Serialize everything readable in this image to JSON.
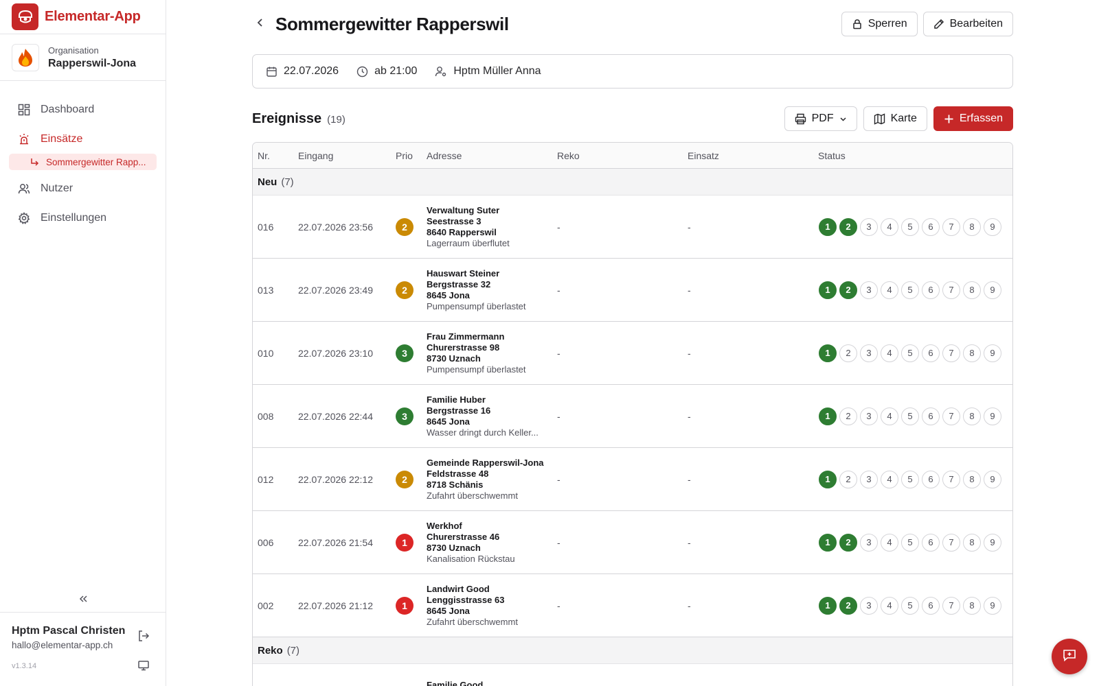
{
  "app": {
    "title": "Elementar-App"
  },
  "org": {
    "label": "Organisation",
    "name": "Rapperswil-Jona"
  },
  "nav": {
    "dashboard": "Dashboard",
    "einsaetze": "Einsätze",
    "sub": "Sommergewitter Rapp...",
    "nutzer": "Nutzer",
    "einstellungen": "Einstellungen"
  },
  "user": {
    "name": "Hptm Pascal Christen",
    "email": "hallo@elementar-app.ch",
    "version": "v1.3.14"
  },
  "page": {
    "title": "Sommergewitter Rapperswil",
    "lock_label": "Sperren",
    "edit_label": "Bearbeiten",
    "date": "22.07.2026",
    "time": "ab 21:00",
    "commander": "Hptm Müller Anna"
  },
  "events": {
    "title": "Ereignisse",
    "count": "(19)",
    "pdf_label": "PDF",
    "map_label": "Karte",
    "add_label": "Erfassen"
  },
  "table": {
    "headers": {
      "nr": "Nr.",
      "eingang": "Eingang",
      "prio": "Prio",
      "adresse": "Adresse",
      "reko": "Reko",
      "einsatz": "Einsatz",
      "status": "Status"
    },
    "groups": [
      {
        "name": "Neu",
        "count": "(7)",
        "rows": [
          {
            "nr": "016",
            "eingang": "22.07.2026 23:56",
            "prio": "2",
            "name": "Verwaltung Suter",
            "street": "Seestrasse 3",
            "city": "8640 Rapperswil",
            "desc": "Lagerraum überflutet",
            "reko": "-",
            "einsatz": "-",
            "status_done": 2
          },
          {
            "nr": "013",
            "eingang": "22.07.2026 23:49",
            "prio": "2",
            "name": "Hauswart Steiner",
            "street": "Bergstrasse 32",
            "city": "8645 Jona",
            "desc": "Pumpensumpf überlastet",
            "reko": "-",
            "einsatz": "-",
            "status_done": 2
          },
          {
            "nr": "010",
            "eingang": "22.07.2026 23:10",
            "prio": "3",
            "name": "Frau Zimmermann",
            "street": "Churerstrasse 98",
            "city": "8730 Uznach",
            "desc": "Pumpensumpf überlastet",
            "reko": "-",
            "einsatz": "-",
            "status_done": 1
          },
          {
            "nr": "008",
            "eingang": "22.07.2026 22:44",
            "prio": "3",
            "name": "Familie Huber",
            "street": "Bergstrasse 16",
            "city": "8645 Jona",
            "desc": "Wasser dringt durch Keller...",
            "reko": "-",
            "einsatz": "-",
            "status_done": 1
          },
          {
            "nr": "012",
            "eingang": "22.07.2026 22:12",
            "prio": "2",
            "name": "Gemeinde Rapperswil-Jona",
            "street": "Feldstrasse 48",
            "city": "8718 Schänis",
            "desc": "Zufahrt überschwemmt",
            "reko": "-",
            "einsatz": "-",
            "status_done": 1
          },
          {
            "nr": "006",
            "eingang": "22.07.2026 21:54",
            "prio": "1",
            "name": "Werkhof",
            "street": "Churerstrasse 46",
            "city": "8730 Uznach",
            "desc": "Kanalisation Rückstau",
            "reko": "-",
            "einsatz": "-",
            "status_done": 2
          },
          {
            "nr": "002",
            "eingang": "22.07.2026 21:12",
            "prio": "1",
            "name": "Landwirt Good",
            "street": "Lenggisstrasse 63",
            "city": "8645 Jona",
            "desc": "Zufahrt überschwemmt",
            "reko": "-",
            "einsatz": "-",
            "status_done": 2
          }
        ]
      },
      {
        "name": "Reko",
        "count": "(7)",
        "rows": [
          {
            "nr": "",
            "eingang": "",
            "prio": "",
            "name": "Familie Good",
            "street": "",
            "city": "",
            "desc": "",
            "reko": "",
            "einsatz": "",
            "status_done": 0,
            "partial": true
          }
        ]
      }
    ],
    "status_steps": [
      "1",
      "2",
      "3",
      "4",
      "5",
      "6",
      "7",
      "8",
      "9"
    ]
  },
  "colors": {
    "brand": "#c62828",
    "prio_1": "#dc2626",
    "prio_2": "#ca8a04",
    "prio_3": "#2e7d32",
    "status_done": "#2e7d32"
  },
  "icons": [
    "shield-logo-icon",
    "flame-icon",
    "dashboard-icon",
    "siren-icon",
    "sub-arrow-icon",
    "users-icon",
    "gear-icon",
    "chevrons-left-icon",
    "logout-icon",
    "monitor-icon",
    "chevron-left-icon",
    "lock-icon",
    "pencil-icon",
    "calendar-icon",
    "clock-icon",
    "user-cog-icon",
    "printer-icon",
    "chevron-down-icon",
    "map-icon",
    "plus-icon",
    "message-plus-icon"
  ]
}
